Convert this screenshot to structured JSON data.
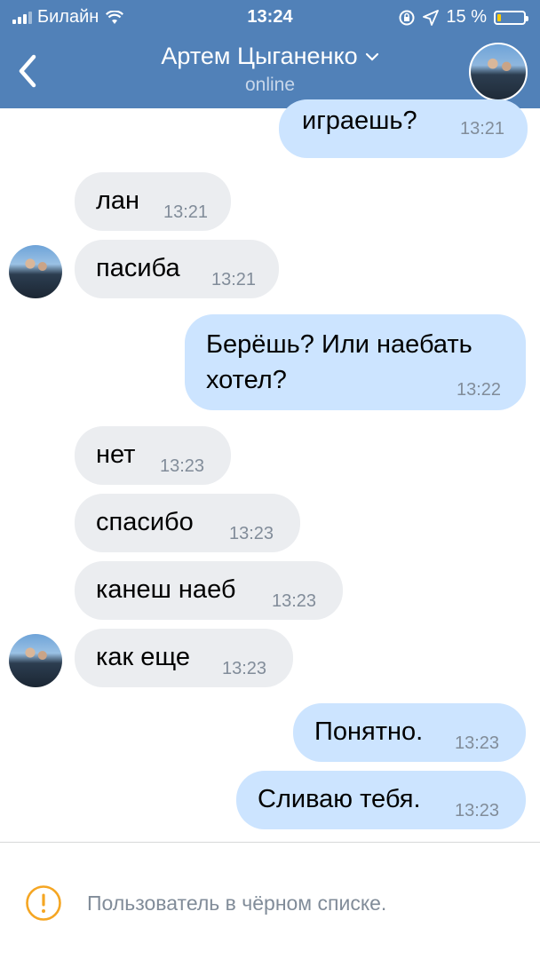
{
  "status_bar": {
    "carrier": "Билайн",
    "time": "13:24",
    "battery": "15 %",
    "battery_level": 0.15
  },
  "header": {
    "contact_name": "Артем Цыганенко",
    "contact_status": "online"
  },
  "messages": [
    {
      "dir": "out",
      "text": "играешь?",
      "time": "13:21"
    },
    {
      "dir": "in",
      "text": "лан",
      "time": "13:21"
    },
    {
      "dir": "in",
      "text": "пасиба",
      "time": "13:21",
      "avatar": true
    },
    {
      "dir": "out",
      "text": "Берёшь? Или наебать",
      "text2": "хотел?",
      "time": "13:22"
    },
    {
      "dir": "in",
      "text": "нет",
      "time": "13:23"
    },
    {
      "dir": "in",
      "text": "спасибо",
      "time": "13:23"
    },
    {
      "dir": "in",
      "text": "канеш наеб",
      "time": "13:23"
    },
    {
      "dir": "in",
      "text": "как еще",
      "time": "13:23",
      "avatar": true
    },
    {
      "dir": "out",
      "text": "Понятно.",
      "time": "13:23"
    },
    {
      "dir": "out",
      "text": "Сливаю тебя.",
      "time": "13:23"
    }
  ],
  "footer": {
    "blocked_text": "Пользователь в чёрном списке.",
    "icon": "warning-icon",
    "warning_color": "#f5a623"
  },
  "colors": {
    "header_bg": "#5181b8",
    "bubble_in": "#ebedf0",
    "bubble_out": "#cce4ff"
  }
}
